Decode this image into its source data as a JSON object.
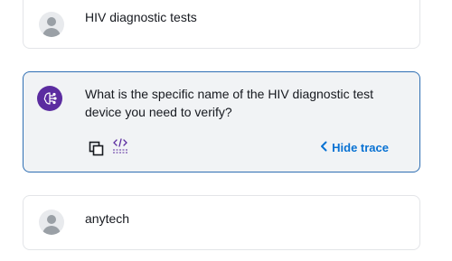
{
  "messages": [
    {
      "role": "user",
      "text": "HIV diagnostic tests"
    },
    {
      "role": "assistant",
      "text": "What is the specific name of the HIV diagnostic test device you need to verify?"
    },
    {
      "role": "user",
      "text": "anytech"
    }
  ],
  "actions": {
    "hide_trace_label": "Hide trace",
    "copy_icon": "copy-icon",
    "trace_icon": "code-trace-icon"
  },
  "colors": {
    "accent": "#0972d3",
    "assistant_border": "#2f6fb3",
    "assistant_bg": "#f1f3f5",
    "bot_avatar": "#5b2ca0"
  }
}
